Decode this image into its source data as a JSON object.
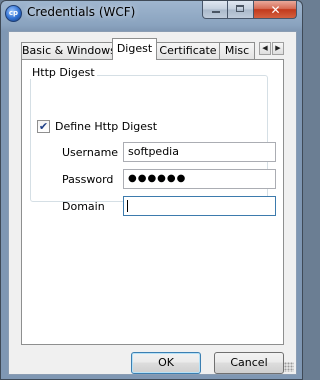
{
  "window": {
    "title": "Credentials (WCF)",
    "close_glyph": "✕"
  },
  "tabs": [
    {
      "label": "Basic & Windows",
      "active": false
    },
    {
      "label": "Digest",
      "active": true
    },
    {
      "label": "Certificate",
      "active": false
    },
    {
      "label": "Misc",
      "active": false
    }
  ],
  "tab_scroll": {
    "left_icon": "◀",
    "right_icon": "▶"
  },
  "digest": {
    "group_label": "Http Digest",
    "define_checkbox": {
      "label": "Define Http Digest",
      "checked": true,
      "mark": "✔"
    },
    "username": {
      "label": "Username",
      "value": "softpedia"
    },
    "password": {
      "label": "Password",
      "value": "●●●●●●"
    },
    "domain": {
      "label": "Domain",
      "value": ""
    }
  },
  "buttons": {
    "ok": "OK",
    "cancel": "Cancel"
  },
  "colors": {
    "accent": "#3d7bad",
    "title_bar": "#8aa3bf",
    "close_button": "#c2391c"
  }
}
